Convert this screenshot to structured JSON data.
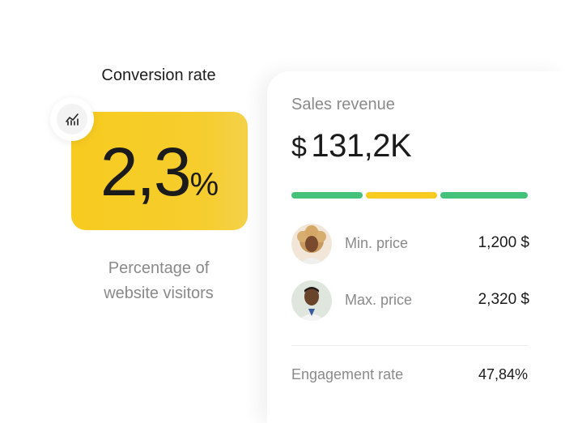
{
  "conversion": {
    "title": "Conversion rate",
    "value": "2,3",
    "unit": "%",
    "description_line1": "Percentage of",
    "description_line2": "website visitors",
    "icon": "chart-line-icon",
    "card_color": "#f7cb1f"
  },
  "sales": {
    "title": "Sales revenue",
    "currency": "$",
    "amount": "131,2K",
    "segments": [
      {
        "color": "#45c27a",
        "share": 0.31
      },
      {
        "color": "#f7cb1f",
        "share": 0.31
      },
      {
        "color": "#45c27a",
        "share": 0.38
      }
    ],
    "min": {
      "label": "Min. price",
      "value": "1,200 $",
      "avatar": "avatar-woman"
    },
    "max": {
      "label": "Max. price",
      "value": "2,320 $",
      "avatar": "avatar-man"
    },
    "engagement": {
      "label": "Engagement rate",
      "value": "47,84%"
    }
  }
}
